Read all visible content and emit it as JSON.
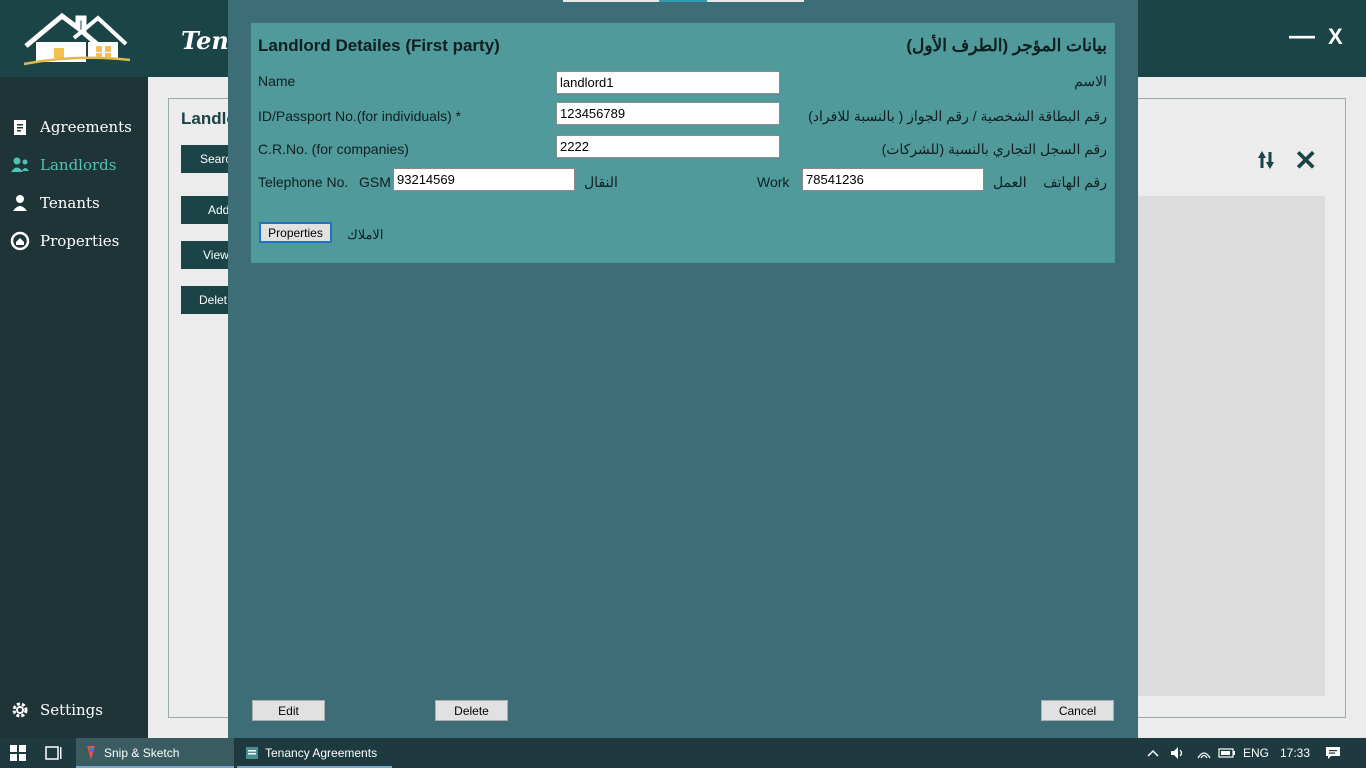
{
  "app": {
    "title": "Tena",
    "min_label": "—",
    "close_label": "X"
  },
  "sidebar": {
    "items": [
      {
        "label": "Agreements",
        "icon": "agreements-icon"
      },
      {
        "label": "Landlords",
        "icon": "landlords-icon",
        "active": true
      },
      {
        "label": "Tenants",
        "icon": "tenants-icon"
      },
      {
        "label": "Properties",
        "icon": "properties-icon"
      }
    ],
    "settings_label": "Settings"
  },
  "background": {
    "title": "Landlo",
    "buttons": [
      "Searc",
      "Add",
      "View",
      "Delet"
    ]
  },
  "dialog": {
    "title_en": "Landlord Detailes (First party)",
    "title_ar": "بيانات المؤجر (الطرف الأول)",
    "name": {
      "label_en": "Name",
      "label_ar": "الاسم",
      "value": "landlord1"
    },
    "id_passport": {
      "label_en": "ID/Passport No.(for individuals) *",
      "label_ar": "رقم البطاقة الشخصية / رقم الجواز ( بالنسبة للافراد)",
      "value": "123456789"
    },
    "crno": {
      "label_en": "C.R.No. (for companies)",
      "label_ar": "رقم السجل التجاري بالنسبة (للشركات)",
      "value": "2222"
    },
    "telephone": {
      "label_en": "Telephone No.",
      "label_ar": "رقم الهاتف",
      "gsm_label": "GSM",
      "gsm_label_ar": "النقال",
      "gsm_value": "93214569",
      "work_label": "Work",
      "work_label_ar": "العمل",
      "work_value": "78541236"
    },
    "properties_button": "Properties",
    "properties_label_ar": "الاملاك",
    "edit_button": "Edit",
    "delete_button": "Delete",
    "cancel_button": "Cancel"
  },
  "taskbar": {
    "apps": [
      "Snip & Sketch",
      "Tenancy Agreements"
    ],
    "language": "ENG",
    "time": "17:33"
  },
  "colors": {
    "header": "#1b4446",
    "sidebar": "#1f3436",
    "active_nav": "#4fc3b4",
    "dialog_bg": "#3d6e78",
    "panel_bg": "#519a9b"
  }
}
